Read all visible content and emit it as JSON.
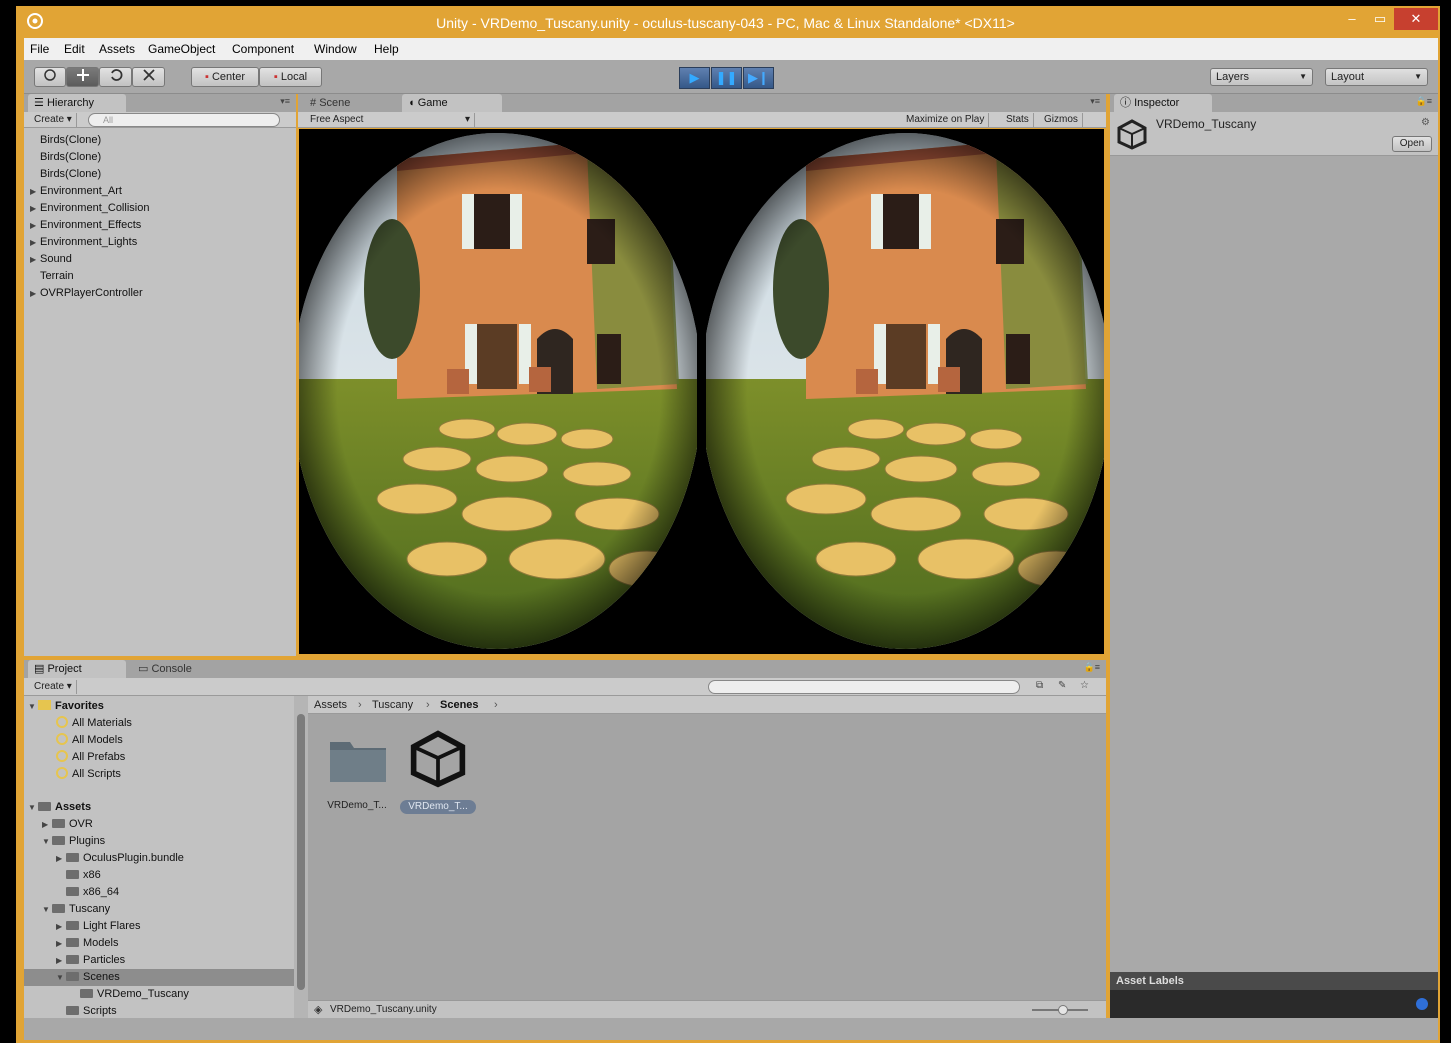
{
  "window": {
    "title": "Unity - VRDemo_Tuscany.unity - oculus-tuscany-043 - PC, Mac & Linux Standalone* <DX11>",
    "min_label": "–",
    "max_label": "▭",
    "close_label": "✕"
  },
  "menu": [
    "File",
    "Edit",
    "Assets",
    "GameObject",
    "Component",
    "Window",
    "Help"
  ],
  "toolbar": {
    "pivot_label": "Center",
    "space_label": "Local",
    "layers_label": "Layers",
    "layout_label": "Layout"
  },
  "hierarchy": {
    "tab_label": "Hierarchy",
    "create_label": "Create",
    "search_placeholder": "All",
    "items": [
      {
        "label": "Birds(Clone)",
        "foldable": false
      },
      {
        "label": "Birds(Clone)",
        "foldable": false
      },
      {
        "label": "Birds(Clone)",
        "foldable": false
      },
      {
        "label": "Environment_Art",
        "foldable": true
      },
      {
        "label": "Environment_Collision",
        "foldable": true
      },
      {
        "label": "Environment_Effects",
        "foldable": true
      },
      {
        "label": "Environment_Lights",
        "foldable": true
      },
      {
        "label": "Sound",
        "foldable": true
      },
      {
        "label": "Terrain",
        "foldable": false
      },
      {
        "label": "OVRPlayerController",
        "foldable": true
      }
    ]
  },
  "scene_tabs": {
    "scene_label": "Scene",
    "game_label": "Game",
    "aspect_label": "Free Aspect",
    "maximize_label": "Maximize on Play",
    "stats_label": "Stats",
    "gizmos_label": "Gizmos"
  },
  "inspector": {
    "tab_label": "Inspector",
    "asset_name": "VRDemo_Tuscany",
    "open_label": "Open",
    "asset_labels_title": "Asset Labels"
  },
  "project": {
    "project_tab": "Project",
    "console_tab": "Console",
    "create_label": "Create",
    "favorites_label": "Favorites",
    "favorites": [
      "All Materials",
      "All Models",
      "All Prefabs",
      "All Scripts"
    ],
    "assets_label": "Assets",
    "tree": [
      {
        "label": "OVR",
        "level": 1
      },
      {
        "label": "Plugins",
        "level": 1
      },
      {
        "label": "OculusPlugin.bundle",
        "level": 2
      },
      {
        "label": "x86",
        "level": 2
      },
      {
        "label": "x86_64",
        "level": 2
      },
      {
        "label": "Tuscany",
        "level": 1
      },
      {
        "label": "Light Flares",
        "level": 2
      },
      {
        "label": "Models",
        "level": 2
      },
      {
        "label": "Particles",
        "level": 2
      },
      {
        "label": "Scenes",
        "level": 2
      },
      {
        "label": "VRDemo_Tuscany",
        "level": 3
      },
      {
        "label": "Scripts",
        "level": 2
      }
    ],
    "breadcrumb": [
      "Assets",
      "Tuscany",
      "Scenes"
    ],
    "breadcrumb_sep": "›",
    "files": [
      "VRDemo_T...",
      "VRDemo_T..."
    ],
    "footer_path": "VRDemo_Tuscany.unity"
  }
}
